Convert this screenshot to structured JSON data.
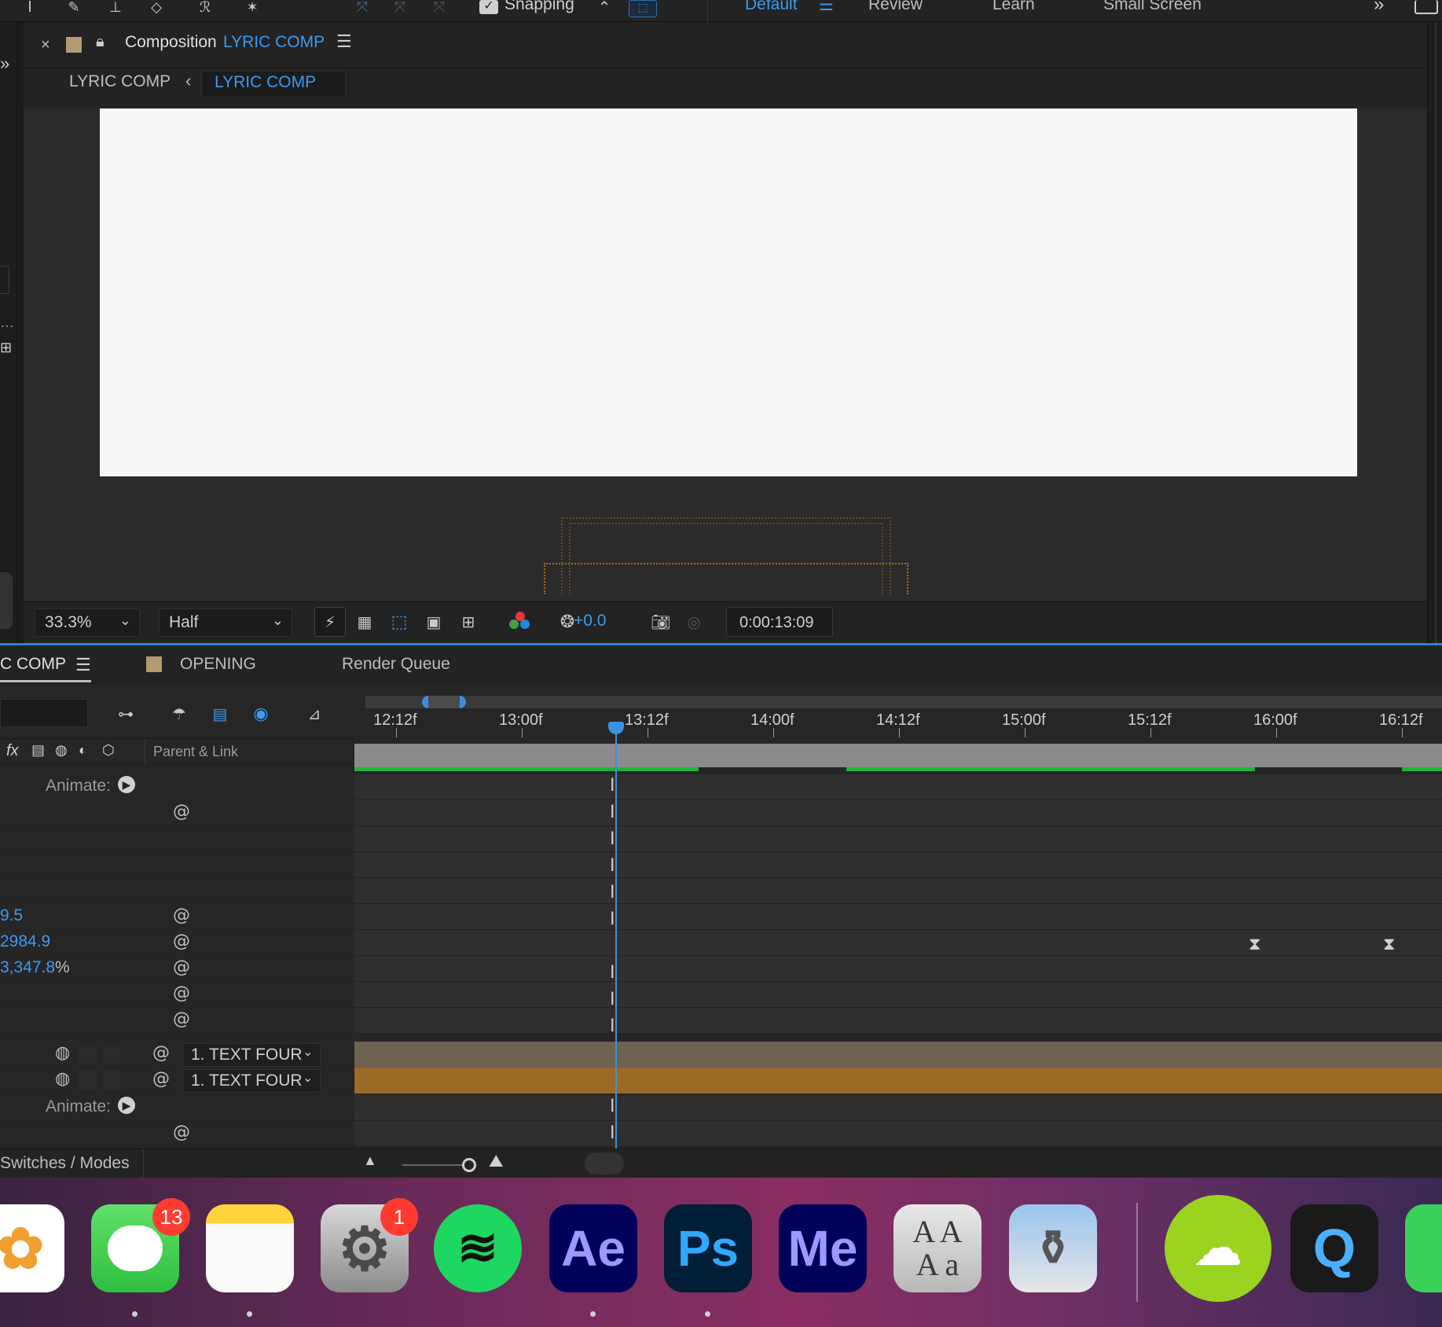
{
  "topbar": {
    "snapping_label": "Snapping",
    "workspaces": [
      "Default",
      "Review",
      "Learn",
      "Small Screen"
    ]
  },
  "composition_panel": {
    "title_prefix": "Composition",
    "comp_name": "LYRIC COMP",
    "breadcrumb_parent": "LYRIC COMP",
    "breadcrumb_current": "LYRIC COMP"
  },
  "viewer_bar": {
    "zoom": "33.3%",
    "resolution": "Half",
    "exposure": "+0.0",
    "timecode": "0:00:13:09"
  },
  "timeline": {
    "tabs": [
      "C COMP",
      "OPENING",
      "Render Queue"
    ],
    "ruler_ticks": [
      "12:12f",
      "13:00f",
      "13:12f",
      "14:00f",
      "14:12f",
      "15:00f",
      "15:12f",
      "16:00f",
      "16:12f"
    ],
    "parent_link_header": "Parent & Link",
    "animate_label": "Animate:",
    "values": [
      "9.5",
      "2984.9",
      "3,347.8"
    ],
    "percent_sign": "%",
    "parent_value": "1. TEXT FOUR",
    "footer_label": "Switches / Modes"
  },
  "dock": {
    "apps": [
      {
        "name": "Photos",
        "icon": "photos-icon"
      },
      {
        "name": "Messages",
        "icon": "messages-icon",
        "badge": "13"
      },
      {
        "name": "Notes",
        "icon": "notes-icon"
      },
      {
        "name": "System Settings",
        "icon": "settings-icon",
        "badge": "1"
      },
      {
        "name": "Spotify",
        "icon": "spotify-icon"
      },
      {
        "name": "After Effects",
        "label": "Ae"
      },
      {
        "name": "Photoshop",
        "label": "Ps"
      },
      {
        "name": "Media Encoder",
        "label": "Me"
      },
      {
        "name": "Font Book",
        "label": "A A\nA a"
      },
      {
        "name": "Preview",
        "icon": "preview-icon"
      },
      {
        "name": "Cloud Video",
        "icon": "cloud-film-icon"
      },
      {
        "name": "QuickTime",
        "icon": "quicktime-icon"
      }
    ]
  },
  "colors": {
    "accent_blue": "#2f8ff0",
    "ae_blue": "#9999ff",
    "ae_bg": "#00005b",
    "ps_blue": "#31a8ff",
    "ps_bg": "#001e36",
    "me_bg": "#00005b",
    "layer_tan": "#6e6251",
    "layer_orange": "#9b6a26",
    "work_green": "#22b33a"
  }
}
